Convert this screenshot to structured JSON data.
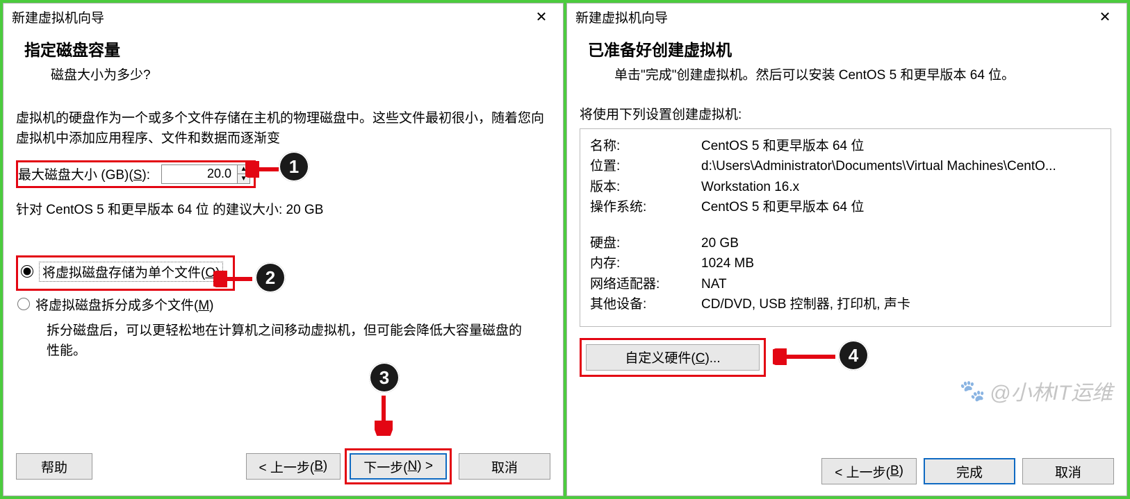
{
  "left": {
    "window_title": "新建虚拟机向导",
    "header_title": "指定磁盘容量",
    "header_sub": "磁盘大小为多少?",
    "desc_line1": "虚拟机的硬盘作为一个或多个文件存储在主机的物理磁盘中。这些文件最初很小，随着您向虚拟机中添加应用程序、文件和数据而逐渐变",
    "size_label_pre": "最大磁盘大小 (GB)(",
    "size_label_hot": "S",
    "size_label_post": "):",
    "size_value": "20.0",
    "recommend": "针对 CentOS 5 和更早版本 64 位 的建议大小: 20 GB",
    "radio_single_pre": "将虚拟磁盘存储为单个文件(",
    "radio_single_hot": "O",
    "radio_single_post": ")",
    "radio_split_pre": "将虚拟磁盘拆分成多个文件(",
    "radio_split_hot": "M",
    "radio_split_post": ")",
    "radio_expl": "拆分磁盘后，可以更轻松地在计算机之间移动虚拟机，但可能会降低大容量磁盘的性能。",
    "footer": {
      "help": "帮助",
      "back": "< 上一步(",
      "back_hot": "B",
      "back_post": ")",
      "next": "下一步(",
      "next_hot": "N",
      "next_post": ") >",
      "cancel": "取消"
    },
    "badges": {
      "b1": "1",
      "b2": "2",
      "b3": "3"
    }
  },
  "right": {
    "window_title": "新建虚拟机向导",
    "header_title": "已准备好创建虚拟机",
    "header_sub": "单击\"完成\"创建虚拟机。然后可以安装 CentOS 5 和更早版本 64 位。",
    "summary_label": "将使用下列设置创建虚拟机:",
    "rows": [
      {
        "k": "名称:",
        "v": "CentOS 5 和更早版本 64 位"
      },
      {
        "k": "位置:",
        "v": "d:\\Users\\Administrator\\Documents\\Virtual Machines\\CentO..."
      },
      {
        "k": "版本:",
        "v": "Workstation 16.x"
      },
      {
        "k": "操作系统:",
        "v": "CentOS 5 和更早版本 64 位"
      }
    ],
    "rows2": [
      {
        "k": "硬盘:",
        "v": "20 GB"
      },
      {
        "k": "内存:",
        "v": "1024 MB"
      },
      {
        "k": "网络适配器:",
        "v": "NAT"
      },
      {
        "k": "其他设备:",
        "v": "CD/DVD, USB 控制器, 打印机, 声卡"
      }
    ],
    "custom_hw_pre": "自定义硬件(",
    "custom_hw_hot": "C",
    "custom_hw_post": ")...",
    "footer": {
      "back": "< 上一步(",
      "back_hot": "B",
      "back_post": ")",
      "finish": "完成",
      "cancel": "取消"
    },
    "badges": {
      "b4": "4"
    }
  },
  "watermark": "@小林IT运维"
}
